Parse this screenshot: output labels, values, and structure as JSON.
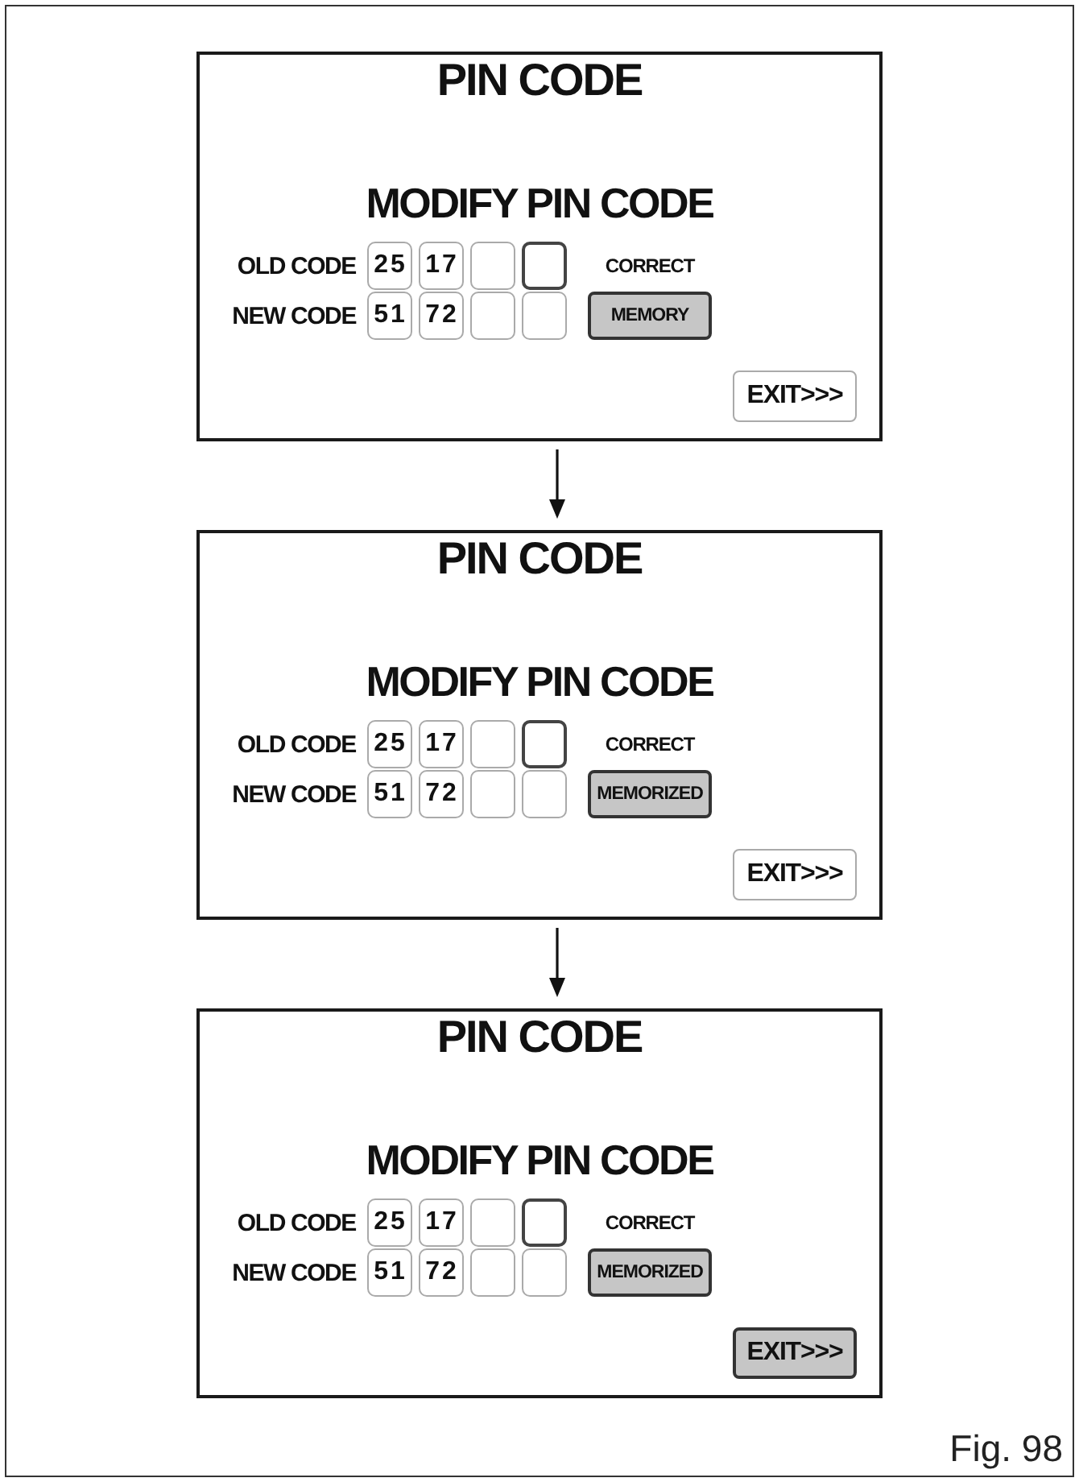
{
  "panels": [
    {
      "title": "PIN CODE",
      "heading": "MODIFY PIN CODE",
      "rows": [
        {
          "label": "OLD CODE",
          "boxes": [
            {
              "value": "25",
              "selected": false
            },
            {
              "value": "17",
              "selected": false
            },
            {
              "selected": false
            },
            {
              "selected": true
            }
          ],
          "side": {
            "kind": "status",
            "text": "CORRECT"
          }
        },
        {
          "label": "NEW CODE",
          "boxes": [
            {
              "value": "51",
              "selected": false
            },
            {
              "value": "72",
              "selected": false
            },
            {
              "selected": false
            },
            {
              "selected": false
            }
          ],
          "side": {
            "kind": "button",
            "text": "MEMORY"
          }
        }
      ],
      "exit_button": {
        "label": "EXIT>>>",
        "selected": false
      }
    },
    {
      "title": "PIN CODE",
      "heading": "MODIFY PIN CODE",
      "rows": [
        {
          "label": "OLD CODE",
          "boxes": [
            {
              "value": "25",
              "selected": false
            },
            {
              "value": "17",
              "selected": false
            },
            {
              "selected": false
            },
            {
              "selected": true
            }
          ],
          "side": {
            "kind": "status",
            "text": "CORRECT"
          }
        },
        {
          "label": "NEW CODE",
          "boxes": [
            {
              "value": "51",
              "selected": false
            },
            {
              "value": "72",
              "selected": false
            },
            {
              "selected": false
            },
            {
              "selected": false
            }
          ],
          "side": {
            "kind": "button",
            "text": "MEMORIZED"
          }
        }
      ],
      "exit_button": {
        "label": "EXIT>>>",
        "selected": false
      }
    },
    {
      "title": "PIN CODE",
      "heading": "MODIFY PIN CODE",
      "rows": [
        {
          "label": "OLD CODE",
          "boxes": [
            {
              "value": "25",
              "selected": false
            },
            {
              "value": "17",
              "selected": false
            },
            {
              "selected": false
            },
            {
              "selected": true
            }
          ],
          "side": {
            "kind": "status",
            "text": "CORRECT"
          }
        },
        {
          "label": "NEW CODE",
          "boxes": [
            {
              "value": "51",
              "selected": false
            },
            {
              "value": "72",
              "selected": false
            },
            {
              "selected": false
            },
            {
              "selected": false
            }
          ],
          "side": {
            "kind": "button",
            "text": "MEMORIZED"
          }
        }
      ],
      "exit_button": {
        "label": "EXIT>>>",
        "selected": true
      }
    }
  ],
  "caption": "Fig. 98"
}
